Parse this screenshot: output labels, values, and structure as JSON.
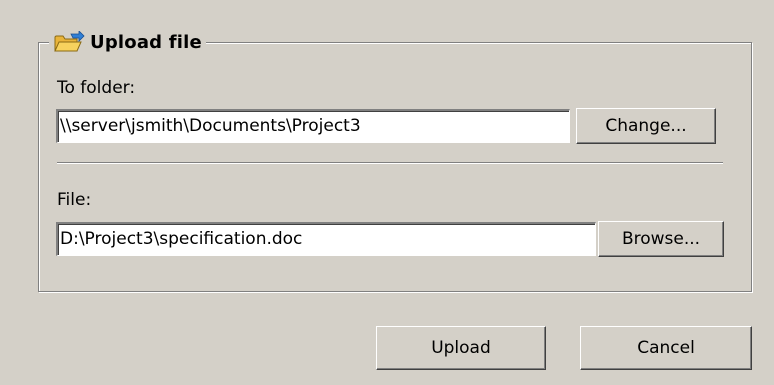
{
  "group": {
    "title": "Upload file",
    "icon": "folder-upload-icon"
  },
  "folder": {
    "label": "To folder:",
    "value": "\\\\server\\jsmith\\Documents\\Project3",
    "button_label": "Change..."
  },
  "file": {
    "label": "File:",
    "value": "D:\\Project3\\specification.doc",
    "button_label": "Browse..."
  },
  "actions": {
    "upload_label": "Upload",
    "cancel_label": "Cancel"
  },
  "colors": {
    "window_bg": "#d4d0c8",
    "field_bg": "#ffffff",
    "shadow": "#808080",
    "highlight": "#ffffff",
    "folder_yellow": "#f4c84a",
    "arrow_blue": "#2f7fd6"
  }
}
